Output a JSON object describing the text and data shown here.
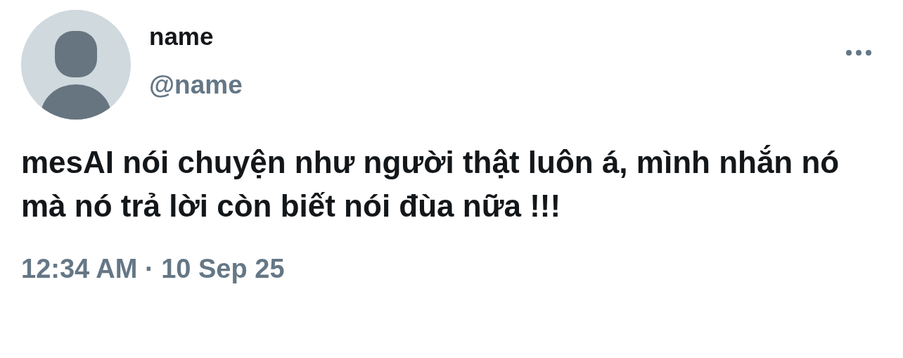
{
  "author": {
    "name": "name",
    "handle": "@name"
  },
  "text": "mesAI nói chuyện như người thật luôn á, mình nhắn nó mà nó trả lời còn biết nói đùa nữa !!!",
  "timestamp": "12:34 AM · 10 Sep 25"
}
